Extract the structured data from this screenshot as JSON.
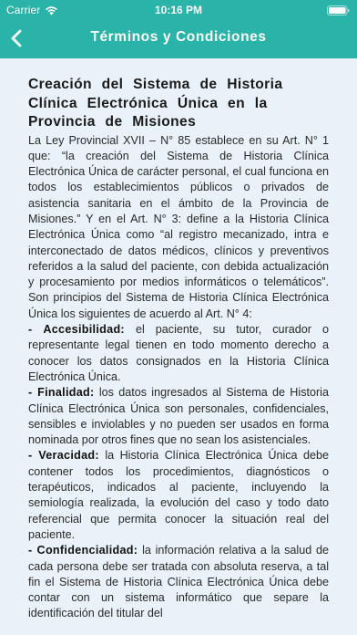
{
  "status_bar": {
    "carrier": "Carrier",
    "time": "10:16 PM"
  },
  "nav": {
    "title": "Términos y Condiciones"
  },
  "colors": {
    "header_bg": "#2ab3a8",
    "page_bg": "#e8f2f8"
  },
  "icons": {
    "wifi": "wifi-icon",
    "battery": "battery-icon",
    "back": "chevron-left-icon"
  },
  "document": {
    "title_lines": [
      "Creación del Sistema de Historia",
      "Clínica Electrónica Única en la",
      "Provincia de Misiones"
    ],
    "intro": "La Ley Provincial XVII – N° 85 establece en su Art. N° 1 que: “la creación del Sistema de Historia Clínica Electrónica Única de carácter personal, el cual funciona en todos los establecimientos públicos o privados de asistencia sanitaria en el ámbito de la Provincia de Misiones.” Y en el Art. N° 3: define a la Historia Clínica Electrónica Única como “al registro mecanizado, intra e interconectado de datos médicos, clínicos y preventivos referidos a la salud del paciente, con debida actualización y procesamiento por medios informáticos o telemáticos”. Son principios del Sistema de Historia Clínica Electrónica Única los siguientes de acuerdo al Art. N° 4:",
    "principles": [
      {
        "term": "- Accesibilidad:",
        "text": " el paciente, su tutor, curador o representante legal tienen en todo momento derecho a conocer los datos consignados en la Historia Clínica Electrónica Única."
      },
      {
        "term": "- Finalidad:",
        "text": " los datos ingresados al Sistema de Historia Clínica Electrónica Única son personales, confidenciales, sensibles e inviolables y no pueden ser usados en forma nominada por otros fines que no sean los asistenciales."
      },
      {
        "term": "- Veracidad:",
        "text": " la Historia Clínica Electrónica Única debe contener todos los procedimientos, diagnósticos o terapéuticos, indicados al paciente, incluyendo la semiología realizada, la evolución del caso y todo dato referencial que permita conocer la situación real del paciente."
      },
      {
        "term": "- Confidencialidad:",
        "text": " la información relativa a la salud de cada persona debe ser tratada con absoluta reserva, a tal fin el Sistema de Historia Clínica Electrónica Única debe contar con un sistema informático que separe la identificación del titular del"
      }
    ]
  }
}
